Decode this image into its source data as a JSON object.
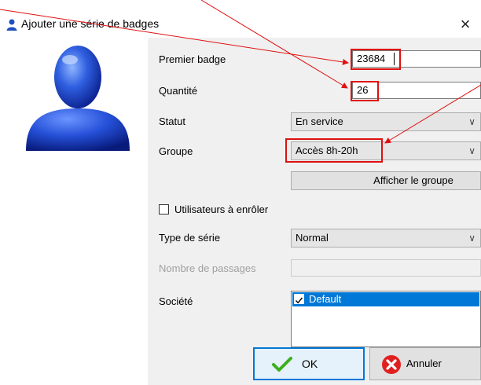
{
  "window": {
    "title": "Ajouter une série de badges",
    "close_glyph": "×",
    "icon": "user-icon"
  },
  "form": {
    "premier_badge": {
      "label": "Premier badge",
      "value": "23684"
    },
    "quantite": {
      "label": "Quantité",
      "value": "26"
    },
    "statut": {
      "label": "Statut",
      "value": "En service"
    },
    "groupe": {
      "label": "Groupe",
      "value": "Accès 8h-20h"
    },
    "afficher_groupe_button": "Afficher le groupe",
    "utilisateurs_checkbox": {
      "label": "Utilisateurs à  enrôler",
      "checked": false
    },
    "type_serie": {
      "label": "Type de série",
      "value": "Normal"
    },
    "nombre_passages": {
      "label": "Nombre de passages",
      "value": "",
      "disabled": true
    },
    "societe": {
      "label": "Société",
      "items": [
        {
          "label": "Default",
          "checked": true,
          "selected": true
        }
      ]
    }
  },
  "buttons": {
    "ok": "OK",
    "annuler": "Annuler"
  },
  "colors": {
    "selection": "#0078d7",
    "annotation": "#e01010",
    "ok_icon": "#3cb01e",
    "cancel_icon": "#e02020"
  }
}
